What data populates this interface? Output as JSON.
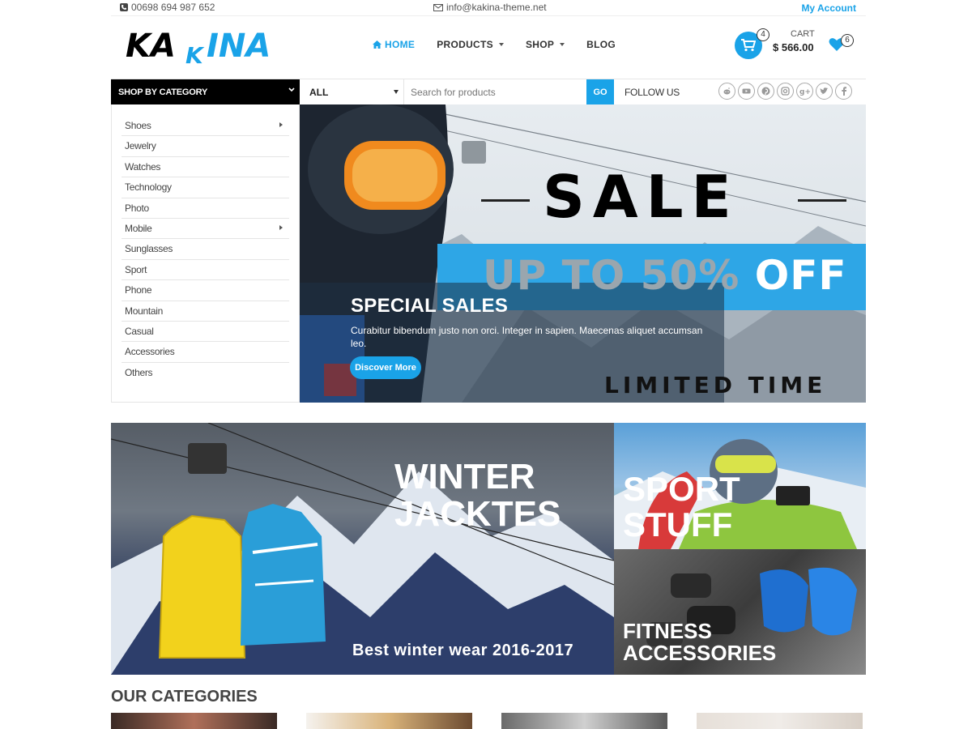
{
  "topbar": {
    "phone": "00698 694 987 652",
    "email": "info@kakina-theme.net",
    "account": "My Account"
  },
  "logo": {
    "text": "KAKINA"
  },
  "nav": [
    {
      "label": "HOME",
      "active": true,
      "icon": "home-icon"
    },
    {
      "label": "PRODUCTS",
      "dropdown": true
    },
    {
      "label": "SHOP",
      "dropdown": true
    },
    {
      "label": "BLOG"
    }
  ],
  "cart": {
    "count": "4",
    "label": "CART",
    "total": "$ 566.00"
  },
  "wishlist": {
    "count": "6"
  },
  "search": {
    "category_header": "SHOP BY CATEGORY",
    "category_selected": "ALL",
    "placeholder": "Search for products",
    "go": "GO",
    "follow": "FOLLOW US"
  },
  "socials": [
    "reddit-icon",
    "youtube-icon",
    "pinterest-icon",
    "instagram-icon",
    "google-plus-icon",
    "twitter-icon",
    "facebook-icon"
  ],
  "categories": [
    {
      "label": "Shoes",
      "has_sub": true
    },
    {
      "label": "Jewelry"
    },
    {
      "label": "Watches"
    },
    {
      "label": "Technology"
    },
    {
      "label": "Photo"
    },
    {
      "label": "Mobile",
      "has_sub": true
    },
    {
      "label": "Sunglasses"
    },
    {
      "label": "Sport"
    },
    {
      "label": "Phone"
    },
    {
      "label": "Mountain"
    },
    {
      "label": "Casual"
    },
    {
      "label": "Accessories"
    },
    {
      "label": "Others"
    }
  ],
  "hero": {
    "sale": "SALE",
    "upto_grey": "UP TO 50%",
    "upto_white": " OFF",
    "title": "SPECIAL SALES",
    "desc": "Curabitur bibendum justo non orci. Integer in sapien. Maecenas aliquet accumsan leo.",
    "button": "Discover More",
    "limited": "LIMITED TIME"
  },
  "banners": {
    "winter": {
      "line1": "WINTER",
      "line2": "JACKTES",
      "sub": "Best winter wear 2016-2017"
    },
    "sport": {
      "line1": "SPORT",
      "line2": "STUFF"
    },
    "fitness": {
      "line1": "FITNESS",
      "line2": "ACCESSORIES"
    }
  },
  "section": {
    "our_categories": "OUR CATEGORIES"
  },
  "colors": {
    "accent": "#1aa3e8",
    "dark": "#000000"
  }
}
